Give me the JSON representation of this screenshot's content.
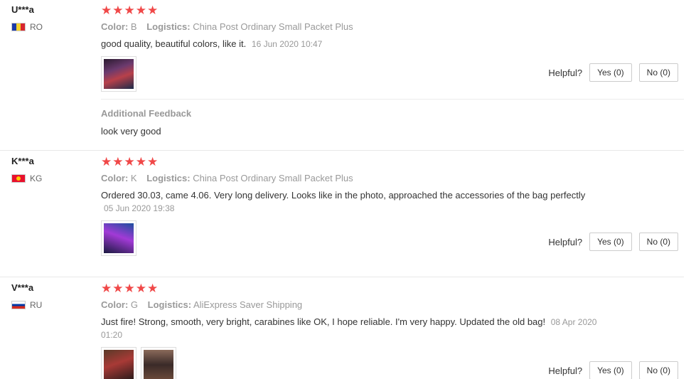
{
  "reviews": [
    {
      "user": "U***a",
      "country": "RO",
      "stars": "★★★★★",
      "color_label": "Color:",
      "color_value": "B",
      "logistics_label": "Logistics:",
      "logistics_value": "China Post Ordinary Small Packet Plus",
      "text": "good quality, beautiful colors, like it.",
      "date": "16 Jun 2020 10:47",
      "helpful_label": "Helpful?",
      "yes_label": "Yes (0)",
      "no_label": "No (0)",
      "additional_title": "Additional Feedback",
      "additional_text": "look very good"
    },
    {
      "user": "K***a",
      "country": "KG",
      "stars": "★★★★★",
      "color_label": "Color:",
      "color_value": "K",
      "logistics_label": "Logistics:",
      "logistics_value": "China Post Ordinary Small Packet Plus",
      "text": "Ordered 30.03, came 4.06. Very long delivery. Looks like in the photo, approached the accessories of the bag perfectly",
      "date": "05 Jun 2020 19:38",
      "helpful_label": "Helpful?",
      "yes_label": "Yes (0)",
      "no_label": "No (0)"
    },
    {
      "user": "V***a",
      "country": "RU",
      "stars": "★★★★★",
      "color_label": "Color:",
      "color_value": "G",
      "logistics_label": "Logistics:",
      "logistics_value": "AliExpress Saver Shipping",
      "text": "Just fire! Strong, smooth, very bright, carabines like OK, I hope reliable. I'm very happy. Updated the old bag!",
      "date": "08 Apr 2020 01:20",
      "helpful_label": "Helpful?",
      "yes_label": "Yes (0)",
      "no_label": "No (0)"
    }
  ],
  "colors": {
    "star": "#f04848",
    "muted": "#999999",
    "text": "#333333"
  }
}
